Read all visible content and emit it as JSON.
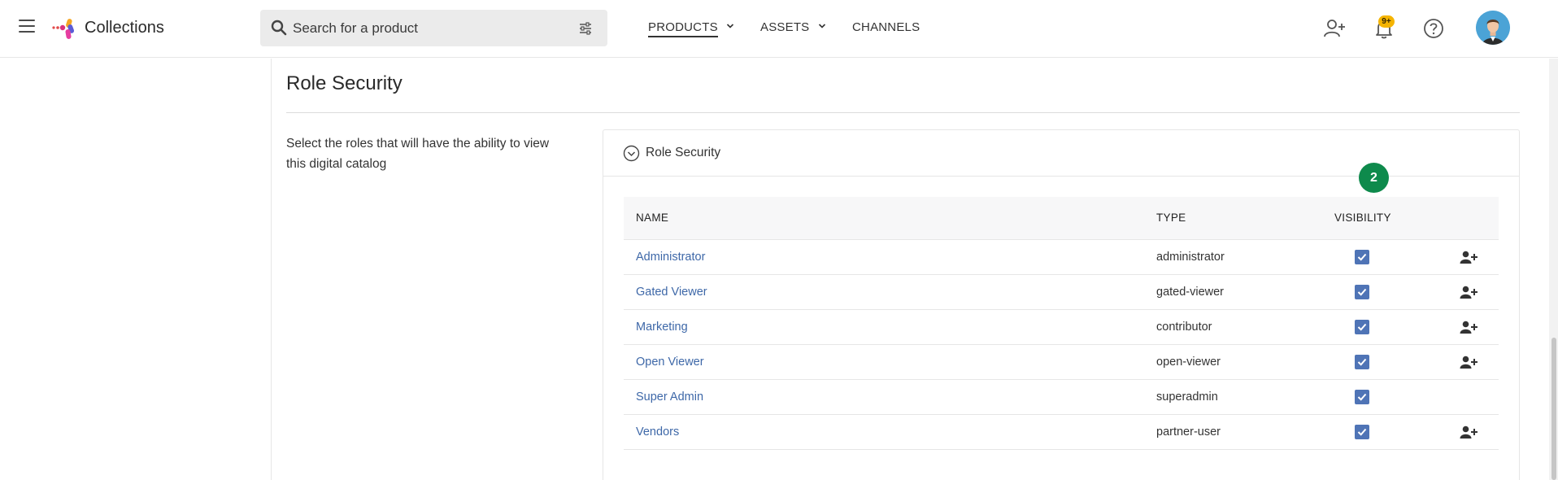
{
  "app": {
    "title": "Collections"
  },
  "search": {
    "placeholder": "Search for a product",
    "value": ""
  },
  "nav": {
    "products": "PRODUCTS",
    "assets": "ASSETS",
    "channels": "CHANNELS",
    "active": "products"
  },
  "notifications": {
    "badge": "9+"
  },
  "section": {
    "title": "Role Security",
    "description": "Select the roles that will have the ability to view this digital catalog"
  },
  "card": {
    "title": "Role Security",
    "step_badge": "2",
    "columns": {
      "name": "NAME",
      "type": "TYPE",
      "visibility": "VISIBILITY"
    },
    "rows": [
      {
        "name": "Administrator",
        "type": "administrator",
        "visible": true,
        "add_user": true
      },
      {
        "name": "Gated Viewer",
        "type": "gated-viewer",
        "visible": true,
        "add_user": true
      },
      {
        "name": "Marketing",
        "type": "contributor",
        "visible": true,
        "add_user": true
      },
      {
        "name": "Open Viewer",
        "type": "open-viewer",
        "visible": true,
        "add_user": true
      },
      {
        "name": "Super Admin",
        "type": "superadmin",
        "visible": true,
        "add_user": false
      },
      {
        "name": "Vendors",
        "type": "partner-user",
        "visible": true,
        "add_user": true
      }
    ]
  },
  "colors": {
    "link": "#3e68a8",
    "checkbox": "#4f74b6",
    "step_badge": "#0e8a4c",
    "notification_badge": "#f5b400",
    "avatar_bg": "#4ba3d6"
  },
  "icons": {
    "menu": "hamburger-icon",
    "search": "search-icon",
    "filter": "filter-sliders-icon",
    "add_user": "add-user-icon",
    "notifications": "bell-icon",
    "help": "help-icon",
    "collapse": "chevron-circle-icon"
  }
}
